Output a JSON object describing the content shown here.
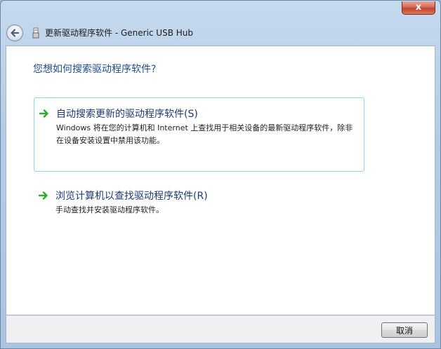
{
  "window": {
    "title": "更新驱动程序软件 - Generic USB Hub",
    "close_label": "x"
  },
  "content": {
    "question": "您想如何搜索驱动程序软件?",
    "options": [
      {
        "title": "自动搜索更新的驱动程序软件(S)",
        "description": "Windows 将在您的计算机和 Internet 上查找用于相关设备的最新驱动程序软件，除非在设备安装设置中禁用该功能。"
      },
      {
        "title": "浏览计算机以查找驱动程序软件(R)",
        "description": "手动查找并安装驱动程序软件。"
      }
    ]
  },
  "footer": {
    "cancel_label": "取消"
  },
  "icons": {
    "back": "back-arrow-icon",
    "device": "usb-device-icon",
    "option_arrow": "green-arrow-icon"
  },
  "colors": {
    "heading": "#1f4e8f",
    "option_border": "#8fd6e6",
    "arrow_green": "#2eaa2e",
    "close_red": "#c1432c"
  }
}
